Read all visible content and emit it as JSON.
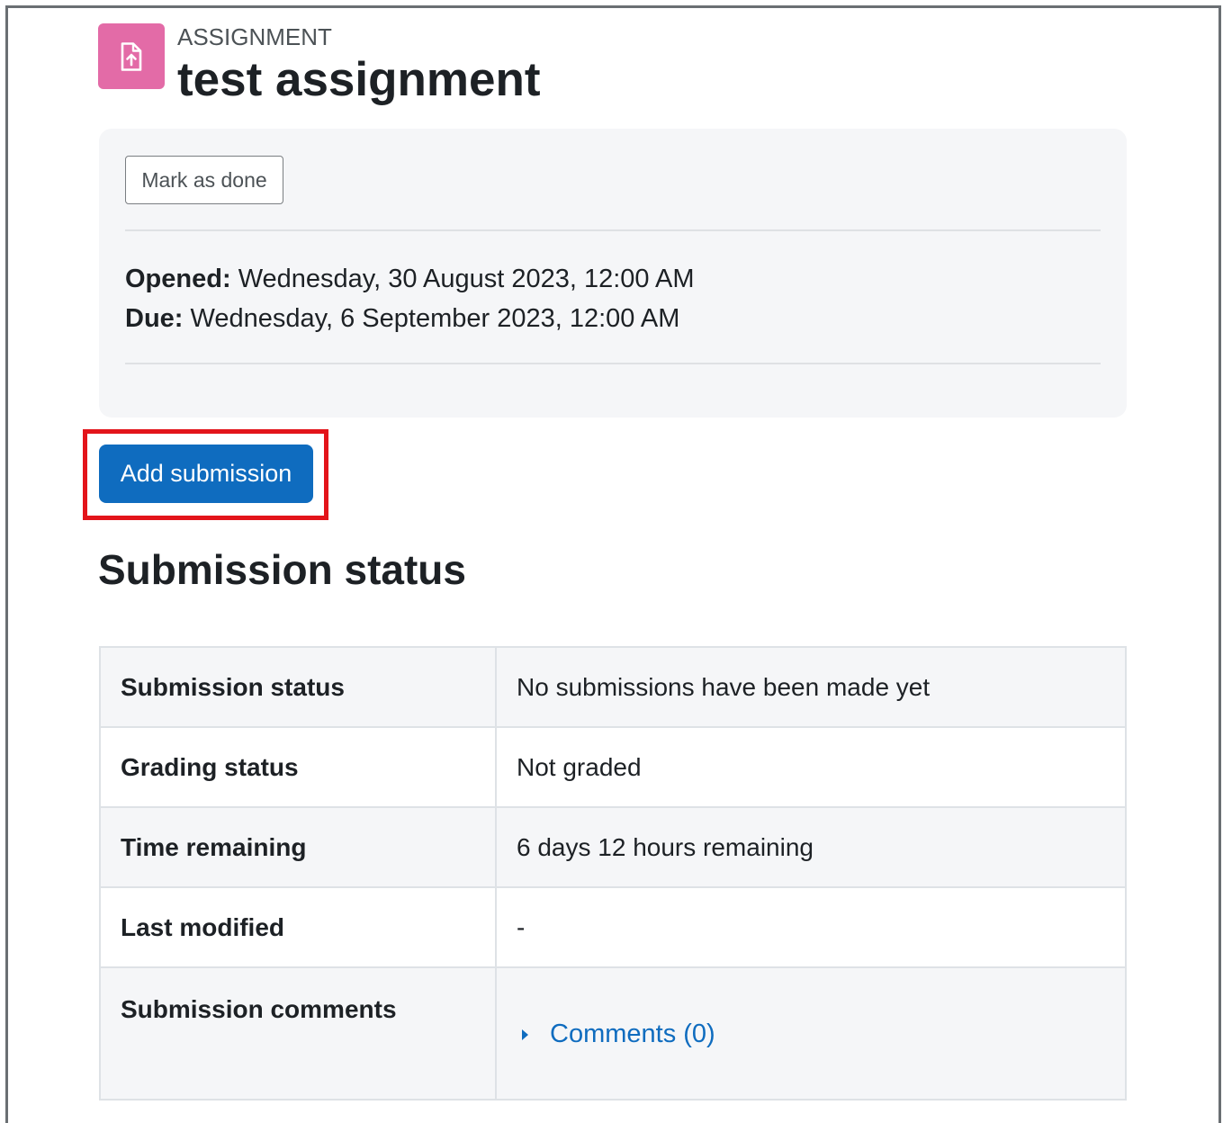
{
  "activity": {
    "type_label": "ASSIGNMENT",
    "title": "test assignment",
    "icon": "file-upload-icon",
    "icon_color": "#e36ba7"
  },
  "completion": {
    "mark_done_label": "Mark as done"
  },
  "dates": {
    "opened_label": "Opened:",
    "opened_value": "Wednesday, 30 August 2023, 12:00 AM",
    "due_label": "Due:",
    "due_value": "Wednesday, 6 September 2023, 12:00 AM"
  },
  "actions": {
    "add_submission_label": "Add submission",
    "primary_color": "#0f6cbf",
    "highlight_color": "#e3141a"
  },
  "submission_status": {
    "heading": "Submission status",
    "rows": [
      {
        "label": "Submission status",
        "value": "No submissions have been made yet"
      },
      {
        "label": "Grading status",
        "value": "Not graded"
      },
      {
        "label": "Time remaining",
        "value": "6 days 12 hours remaining"
      },
      {
        "label": "Last modified",
        "value": "-"
      },
      {
        "label": "Submission comments",
        "value": "Comments (0)"
      }
    ]
  }
}
